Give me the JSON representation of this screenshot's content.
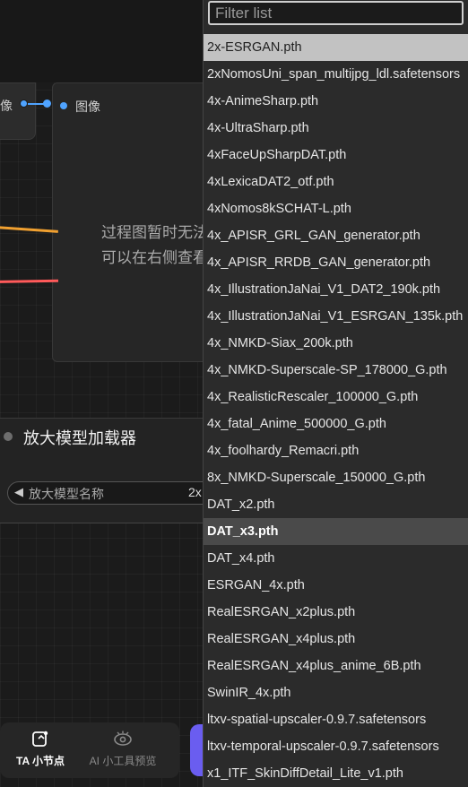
{
  "canvas": {
    "input_label": "像",
    "preview_node": {
      "title": "图像",
      "message_line1": "过程图暂时无法",
      "message_line2": "可以在右侧查看"
    },
    "loader_node": {
      "title": "放大模型加载器",
      "widget_label": "放大模型名称",
      "widget_value": "2x"
    },
    "bottom_bar": {
      "ta_label": "TA 小节点",
      "ai_label": "AI 小工具预览"
    }
  },
  "dropdown": {
    "filter_placeholder": "Filter list",
    "items": [
      "2x-ESRGAN.pth",
      "2xNomosUni_span_multijpg_ldl.safetensors",
      "4x-AnimeSharp.pth",
      "4x-UltraSharp.pth",
      "4xFaceUpSharpDAT.pth",
      "4xLexicaDAT2_otf.pth",
      "4xNomos8kSCHAT-L.pth",
      "4x_APISR_GRL_GAN_generator.pth",
      "4x_APISR_RRDB_GAN_generator.pth",
      "4x_IllustrationJaNai_V1_DAT2_190k.pth",
      "4x_IllustrationJaNai_V1_ESRGAN_135k.pth",
      "4x_NMKD-Siax_200k.pth",
      "4x_NMKD-Superscale-SP_178000_G.pth",
      "4x_RealisticRescaler_100000_G.pth",
      "4x_fatal_Anime_500000_G.pth",
      "4x_foolhardy_Remacri.pth",
      "8x_NMKD-Superscale_150000_G.pth",
      "DAT_x2.pth",
      "DAT_x3.pth",
      "DAT_x4.pth",
      "ESRGAN_4x.pth",
      "RealESRGAN_x2plus.pth",
      "RealESRGAN_x4plus.pth",
      "RealESRGAN_x4plus_anime_6B.pth",
      "SwinIR_4x.pth",
      "ltxv-spatial-upscaler-0.9.7.safetensors",
      "ltxv-temporal-upscaler-0.9.7.safetensors",
      "x1_ITF_SkinDiffDetail_Lite_v1.pth"
    ],
    "highlighted_index": 0,
    "selected_index": 18
  },
  "colors": {
    "link_blue": "#4fa3ff",
    "wire_orange": "#f0a030",
    "wire_pink": "#ff5a5a",
    "accent_purple": "#6a5df0"
  },
  "icons": [
    "node-card-icon",
    "eye-icon",
    "arrow-left-icon"
  ]
}
